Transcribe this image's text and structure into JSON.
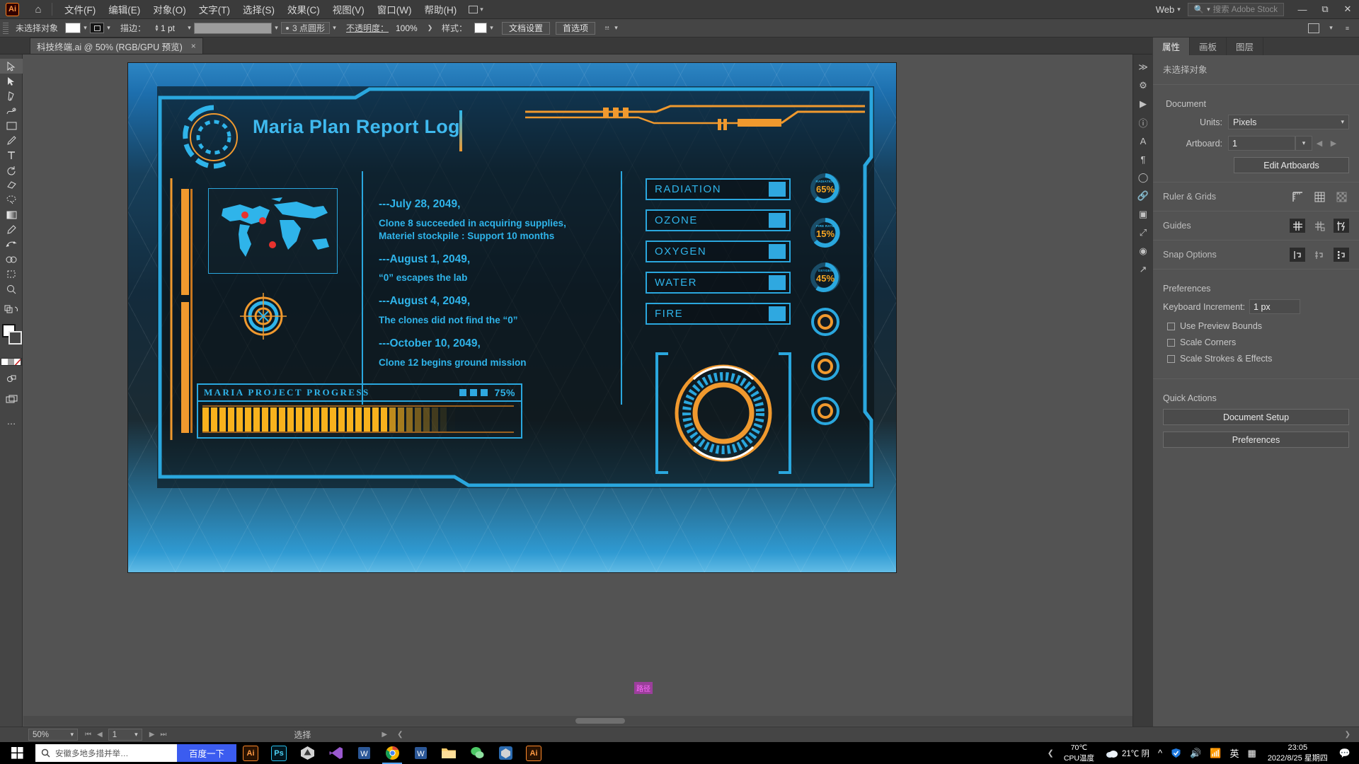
{
  "app": {
    "logo": "Ai",
    "home_icon": "home-icon",
    "menus": [
      "文件(F)",
      "编辑(E)",
      "对象(O)",
      "文字(T)",
      "选择(S)",
      "效果(C)",
      "视图(V)",
      "窗口(W)",
      "帮助(H)"
    ],
    "workspace": "Web",
    "search_placeholder": "搜索 Adobe Stock",
    "window_buttons": [
      "minimize",
      "maximize",
      "close"
    ]
  },
  "control_bar": {
    "selection_status": "未选择对象",
    "fill_swatch": "#ffffff",
    "stroke_label": "描边：",
    "stroke_weight": "1 pt",
    "brush_definition": "3 点圆形",
    "opacity_label": "不透明度：",
    "opacity_value": "100%",
    "style_label": "样式：",
    "document_setup": "文档设置",
    "preferences": "首选项"
  },
  "document_tab": {
    "title": "科技终端.ai @ 50% (RGB/GPU 预览)",
    "close": "×"
  },
  "toolbar": {
    "tools": [
      "selection-tool",
      "direct-selection-tool",
      "pen-tool",
      "curvature-tool",
      "rectangle-tool",
      "paintbrush-tool",
      "type-tool",
      "rotate-tool",
      "eraser-tool",
      "lasso-tool",
      "gradient-tool",
      "eyedropper-tool",
      "blend-tool",
      "shape-builder-tool",
      "artboard-tool",
      "zoom-tool"
    ],
    "fill_color": "#ffffff",
    "stroke_color": "#454545",
    "more_tools": "…"
  },
  "artwork": {
    "title": "Maria Plan Report Log",
    "log_entries": [
      {
        "date": "---July 28, 2049,",
        "lines": [
          "Clone 8 succeeded in acquiring supplies,",
          "Materiel stockpile : Support 10 months"
        ]
      },
      {
        "date": "---August 1, 2049,",
        "lines": [
          "“0” escapes the lab"
        ]
      },
      {
        "date": "---August 4, 2049,",
        "lines": [
          "The clones did not find the “0”"
        ]
      },
      {
        "date": "---October 10, 2049,",
        "lines": [
          "Clone 12 begins ground mission"
        ]
      }
    ],
    "status_rows": [
      "RADIATION",
      "OZONE",
      "OXYGEN",
      "WATER",
      "FIRE"
    ],
    "gauges": [
      {
        "label": "RADIATION",
        "value": "65%"
      },
      {
        "label": "FIRE RATE",
        "value": "15%"
      },
      {
        "label": "OXYGEN",
        "value": "45%"
      },
      {
        "label": "",
        "value": ""
      },
      {
        "label": "",
        "value": ""
      },
      {
        "label": "",
        "value": ""
      }
    ],
    "progress": {
      "title": "MARIA  PROJECT  PROGRESS",
      "percent": "75%",
      "percent_value": 75,
      "bar_count": 30,
      "filled_count": 22
    },
    "accent_blue": "#2aa7de",
    "accent_orange": "#f0992e",
    "text_blue": "#2fb4ea"
  },
  "properties_panel": {
    "tabs": [
      "属性",
      "画板",
      "图层"
    ],
    "active_tab": "属性",
    "selection_status": "未选择对象",
    "document_header": "Document",
    "units_label": "Units:",
    "units_value": "Pixels",
    "artboard_label": "Artboard:",
    "artboard_value": "1",
    "edit_artboards": "Edit Artboards",
    "ruler_grids_label": "Ruler & Grids",
    "guides_label": "Guides",
    "snap_options_label": "Snap Options",
    "preferences_header": "Preferences",
    "keyboard_increment_label": "Keyboard Increment:",
    "keyboard_increment_value": "1 px",
    "checkboxes": [
      "Use Preview Bounds",
      "Scale Corners",
      "Scale Strokes & Effects"
    ],
    "quick_actions_header": "Quick Actions",
    "quick_actions": [
      "Document Setup",
      "Preferences"
    ]
  },
  "status_bar": {
    "zoom": "50%",
    "artboard_number": "1",
    "tool_status": "选择"
  },
  "canvas_annotation": {
    "path_label": "路径"
  },
  "taskbar": {
    "search_text": "安徽多地多措并举…",
    "baidu_button": "百度一下",
    "apps": [
      "Ai",
      "Ps",
      "unity",
      "vscode",
      "word",
      "chrome",
      "word2",
      "explorer",
      "wechat",
      "unity2",
      "Ai2"
    ],
    "cpu_temp": "70℃",
    "cpu_label": "CPU温度",
    "weather_temp": "21℃ 阴",
    "ime": "英",
    "time": "23:05",
    "date": "2022/8/25 星期四"
  }
}
